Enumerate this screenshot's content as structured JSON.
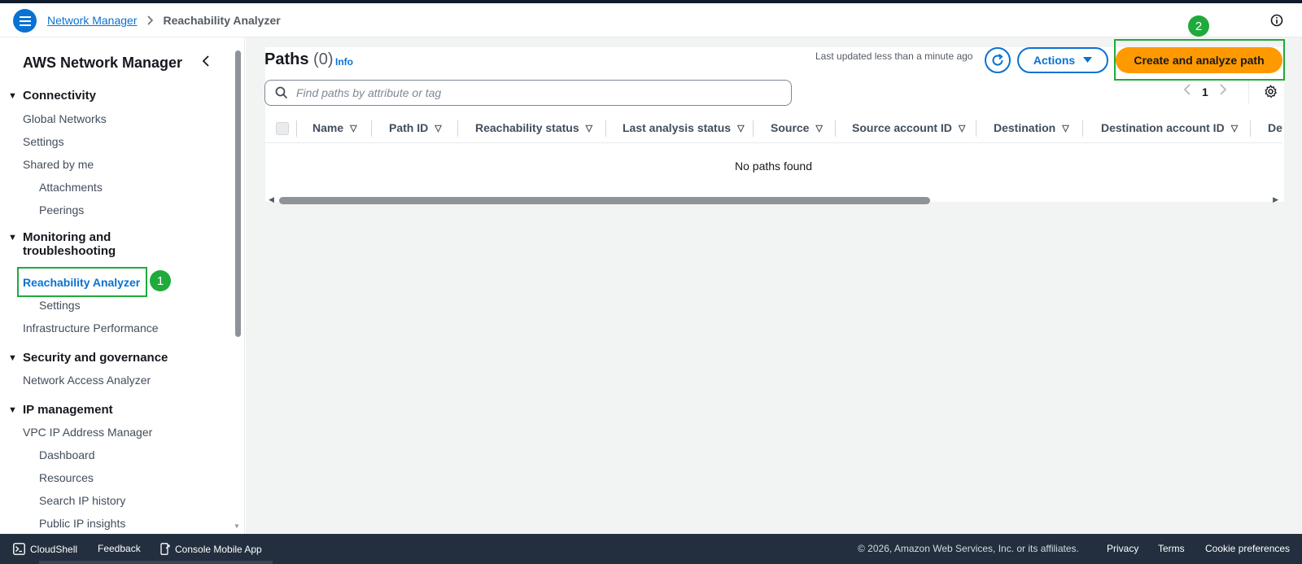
{
  "header": {
    "breadcrumb_root": "Network Manager",
    "breadcrumb_current": "Reachability Analyzer"
  },
  "sidebar": {
    "title": "AWS Network Manager",
    "sections": {
      "connectivity": "Connectivity",
      "monitoring_line1": "Monitoring and",
      "monitoring_line2": "troubleshooting",
      "security": "Security and governance",
      "ip_management": "IP management"
    },
    "items": {
      "global_networks": "Global Networks",
      "settings": "Settings",
      "shared_by_me": "Shared by me",
      "attachments": "Attachments",
      "peerings": "Peerings",
      "reachability_analyzer": "Reachability Analyzer",
      "ra_settings": "Settings",
      "infrastructure_performance": "Infrastructure Performance",
      "network_access_analyzer": "Network Access Analyzer",
      "vpc_ipam": "VPC IP Address Manager",
      "dashboard": "Dashboard",
      "resources": "Resources",
      "search_ip_history": "Search IP history",
      "public_ip_insights": "Public IP insights"
    }
  },
  "markers": {
    "one": "1",
    "two": "2"
  },
  "main": {
    "title": "Paths",
    "count": "(0)",
    "info_link": "Info",
    "last_updated": "Last updated less than a minute ago",
    "actions_label": "Actions",
    "create_label": "Create and analyze path",
    "search_placeholder": "Find paths by attribute or tag",
    "page_number": "1",
    "columns": {
      "name": "Name",
      "path_id": "Path ID",
      "reachability_status": "Reachability status",
      "last_analysis_status": "Last analysis status",
      "source": "Source",
      "source_account_id": "Source account ID",
      "destination": "Destination",
      "destination_account_id": "Destination account ID",
      "truncated": "De"
    },
    "empty_message": "No paths found"
  },
  "footer": {
    "cloudshell": "CloudShell",
    "feedback": "Feedback",
    "console_mobile_app": "Console Mobile App",
    "copyright": "© 2026, Amazon Web Services, Inc. or its affiliates.",
    "privacy": "Privacy",
    "terms": "Terms",
    "cookie_preferences": "Cookie preferences"
  },
  "colors": {
    "accent_blue": "#0972d3",
    "primary_orange": "#ff9900",
    "highlight_green": "#1faa3c",
    "footer_bg": "#232f3e"
  },
  "icons": [
    "hamburger-menu-icon",
    "chevron-right-icon",
    "info-circle-icon",
    "chevron-left-icon",
    "caret-down-icon",
    "refresh-icon",
    "search-icon",
    "settings-gear-icon",
    "cloudshell-icon",
    "mobile-app-icon",
    "sort-icon"
  ]
}
